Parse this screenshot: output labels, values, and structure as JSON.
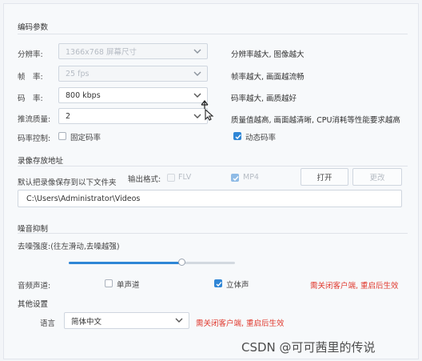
{
  "encoding": {
    "section_title": "编码参数",
    "resolution": {
      "label": "分辨率:",
      "value": "1366x768 屏幕尺寸",
      "hint": "分辨率越大, 图像越大"
    },
    "framerate": {
      "label": "帧　率:",
      "value": "25 fps",
      "hint": "帧率越大, 画面越流畅"
    },
    "bitrate": {
      "label": "码　率:",
      "value": "800 kbps",
      "hint": "码率越大, 画质越好"
    },
    "quality": {
      "label": "推流质量:",
      "value": "2",
      "hint": "质量值越高, 画面越清晰, CPU消耗等性能要求越高"
    },
    "rate_control": {
      "label": "码率控制:",
      "fixed_label": "固定码率",
      "fixed_checked": false,
      "dynamic_label": "动态码率",
      "dynamic_checked": true
    }
  },
  "recording": {
    "section_title": "录像存放地址",
    "path_label": "默认把录像保存到以下文件夹",
    "format_label": "输出格式:",
    "flv_label": "FLV",
    "flv_checked": false,
    "mp4_label": "MP4",
    "mp4_checked": true,
    "open_button": "打开",
    "change_button": "更改",
    "path_value": "C:\\Users\\Administrator\\Videos"
  },
  "noise": {
    "section_title": "噪音抑制",
    "strength_label": "去噪强度:(往左滑动,去噪越强)",
    "slider_value": 0.68
  },
  "audio_channel": {
    "label": "音频声道:",
    "mono_label": "单声道",
    "mono_checked": false,
    "stereo_label": "立体声",
    "stereo_checked": true,
    "restart_note": "需关闭客户端, 重启后生效"
  },
  "other": {
    "section_title": "其他设置",
    "language_label": "语言",
    "language_value": "简体中文",
    "restart_note": "需关闭客户端, 重启后生效"
  },
  "watermark": "CSDN @可可茜里的传说",
  "colors": {
    "accent": "#2f86d6",
    "warning": "#e03a2f"
  }
}
